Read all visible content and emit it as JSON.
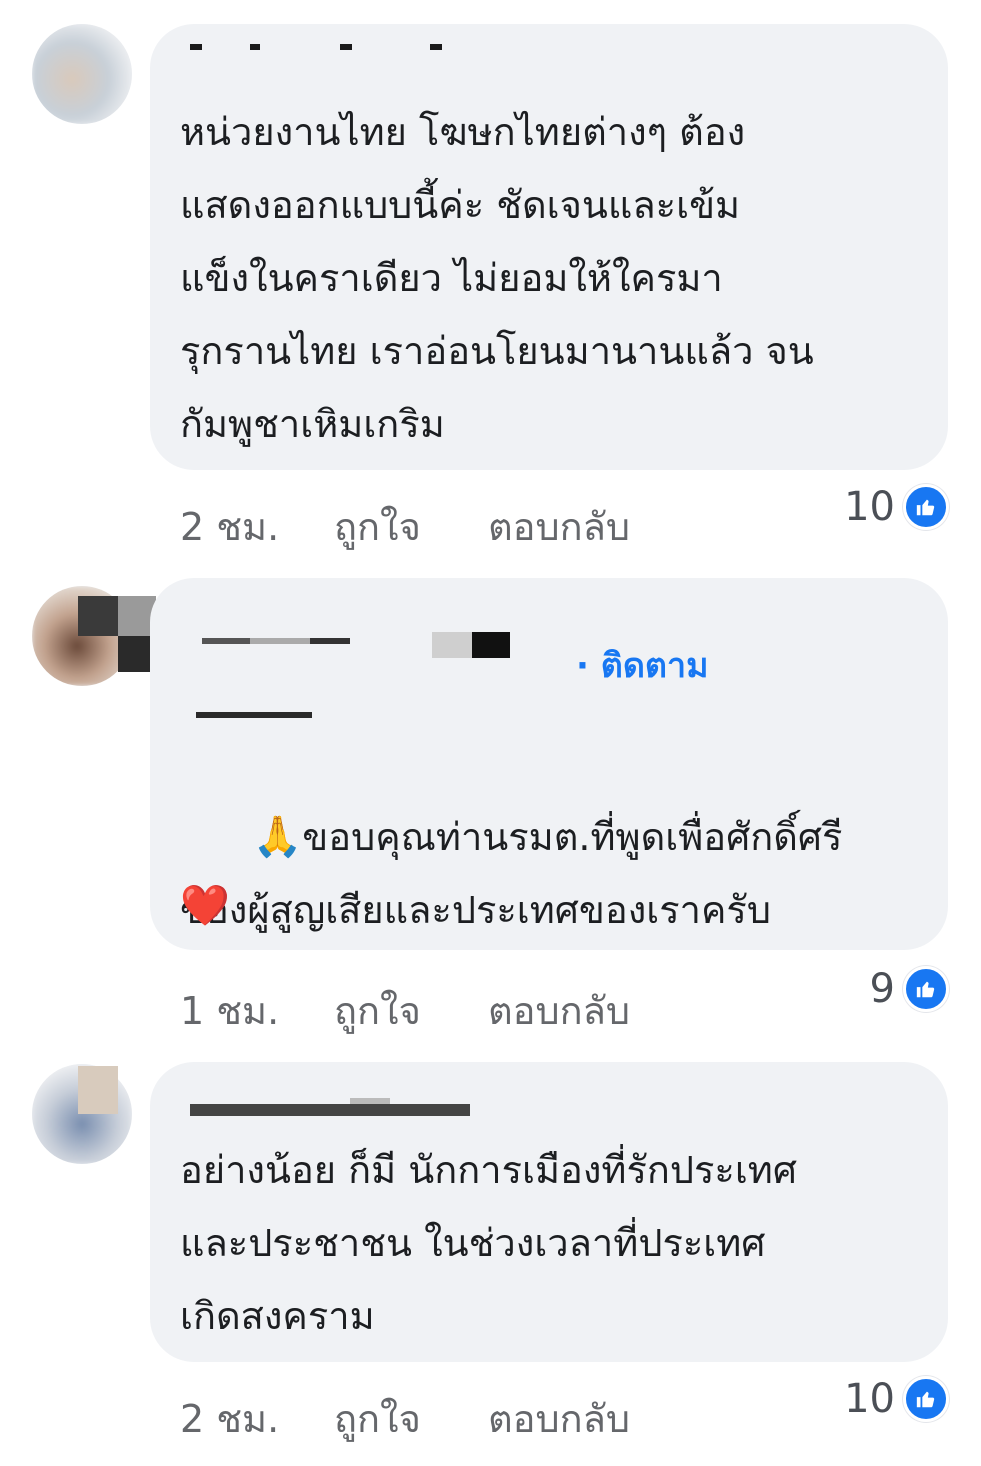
{
  "colors": {
    "bubble": "#f0f2f5",
    "text": "#1c1e21",
    "meta": "#65676b",
    "link": "#1877f2",
    "like": "#1877f2"
  },
  "comments": [
    {
      "text": "หน่วยงานไทย โฆษกไทยต่างๆ ต้อง\nแสดงออกแบบนี้ค่ะ ชัดเจนและเข้ม\nแข็งในคราเดียว ไม่ยอมให้ใครมา\nรุกรานไทย เราอ่อนโยนมานานแล้ว จน\nกัมพูชาเหิมเกริม",
      "time": "2 ชม.",
      "like_label": "ถูกใจ",
      "reply_label": "ตอบกลับ",
      "reactions": "10"
    },
    {
      "follow_label": "· ติดตาม",
      "text_emoji": "🙏",
      "text": "ขอบคุณท่านรมต.ที่พูดเพื่อศักดิ์ศรี\nของผู้สูญเสียและประเทศของเราครับ",
      "text_emoji_end": "❤️",
      "time": "1 ชม.",
      "like_label": "ถูกใจ",
      "reply_label": "ตอบกลับ",
      "reactions": "9"
    },
    {
      "text": "อย่างน้อย ก็มี นักการเมืองที่รักประเทศ\nและประชาชน ในช่วงเวลาที่ประเทศ\nเกิดสงคราม",
      "time": "2 ชม.",
      "like_label": "ถูกใจ",
      "reply_label": "ตอบกลับ",
      "reactions": "10"
    }
  ]
}
